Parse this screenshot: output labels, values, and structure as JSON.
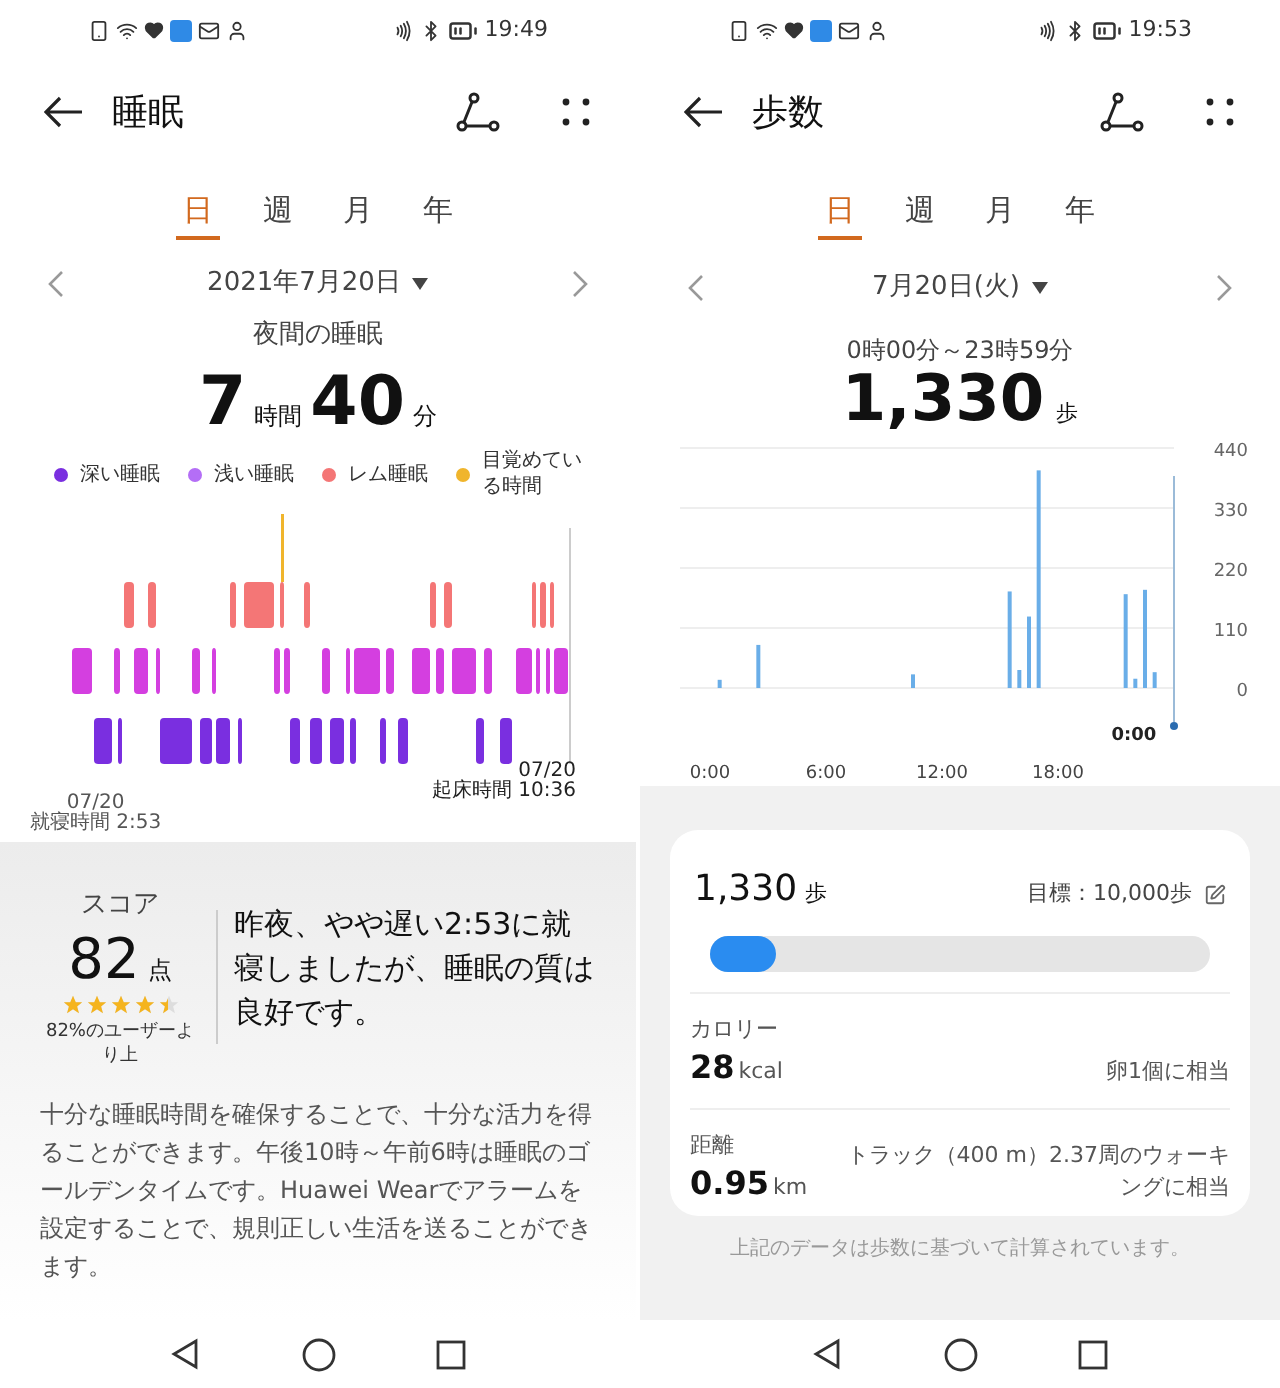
{
  "sleep_screen": {
    "status_bar": {
      "time": "19:49"
    },
    "header": {
      "title": "睡眠"
    },
    "tabs": [
      {
        "label": "日",
        "selected": true
      },
      {
        "label": "週",
        "selected": false
      },
      {
        "label": "月",
        "selected": false
      },
      {
        "label": "年",
        "selected": false
      }
    ],
    "date": "2021年7月20日",
    "subtitle": "夜間の睡眠",
    "duration": {
      "hours": "7",
      "hours_unit": "時間",
      "minutes": "40",
      "minutes_unit": "分"
    },
    "legend": [
      {
        "label": "深い睡眠",
        "color": "#7a2fe0"
      },
      {
        "label": "浅い睡眠",
        "color": "#b46ef6"
      },
      {
        "label": "レム睡眠",
        "color": "#f47676"
      },
      {
        "label": "目覚めている時間",
        "color": "#f0b52c"
      }
    ],
    "bedtime": {
      "date": "07/20",
      "label": "就寝時間 2:53"
    },
    "wake": {
      "date": "07/20",
      "label": "起床時間 10:36"
    },
    "score": {
      "label": "スコア",
      "value": "82",
      "unit": "点",
      "stars": 4.5,
      "percentile": "82%のユーザーより上"
    },
    "summary": "昨夜、やや遅い2:53に就寝しましたが、睡眠の質は良好です。",
    "advice": "十分な睡眠時間を確保することで、十分な活力を得ることができます。午後10時～午前6時は睡眠のゴールデンタイムです。Huawei Wearでアラームを設定することで、規則正しい生活を送ることができます。"
  },
  "steps_screen": {
    "status_bar": {
      "time": "19:53"
    },
    "header": {
      "title": "歩数"
    },
    "tabs": [
      {
        "label": "日",
        "selected": true
      },
      {
        "label": "週",
        "selected": false
      },
      {
        "label": "月",
        "selected": false
      },
      {
        "label": "年",
        "selected": false
      }
    ],
    "date": "7月20日(火)",
    "range": "0時00分～23時59分",
    "total": {
      "value": "1,330",
      "unit": "歩"
    },
    "chart_data": {
      "type": "bar",
      "x": [
        0.5,
        2.5,
        10.5,
        15.5,
        16,
        16.5,
        17,
        21.5,
        22,
        22.5,
        23
      ],
      "series": [
        {
          "color": "#6aaee8",
          "values": [
            15,
            79,
            25,
            177,
            33,
            131,
            399,
            172,
            17,
            180,
            29
          ]
        }
      ],
      "xlim": [
        0,
        24
      ],
      "ylim": [
        0,
        440
      ],
      "grid": true,
      "xticks": [
        {
          "value": 0,
          "label": "0:00"
        },
        {
          "value": 6,
          "label": "6:00"
        },
        {
          "value": 12,
          "label": "12:00"
        },
        {
          "value": 18,
          "label": "18:00"
        }
      ],
      "yticks": [
        0,
        110,
        220,
        330,
        440
      ]
    },
    "cursor_label": "0:00",
    "card": {
      "steps": "1,330",
      "unit": "歩",
      "goal": "目標：10,000歩",
      "level": 0.133
    },
    "metrics": [
      {
        "label": "カロリー",
        "value": "28",
        "unit": "kcal",
        "note": "卵1個に相当"
      },
      {
        "label": "距離",
        "value": "0.95",
        "unit": "km",
        "note": "トラック（400 m）2.37周のウォーキングに相当"
      }
    ],
    "footnote": "上記のデータは歩数に基づいて計算されています。"
  }
}
